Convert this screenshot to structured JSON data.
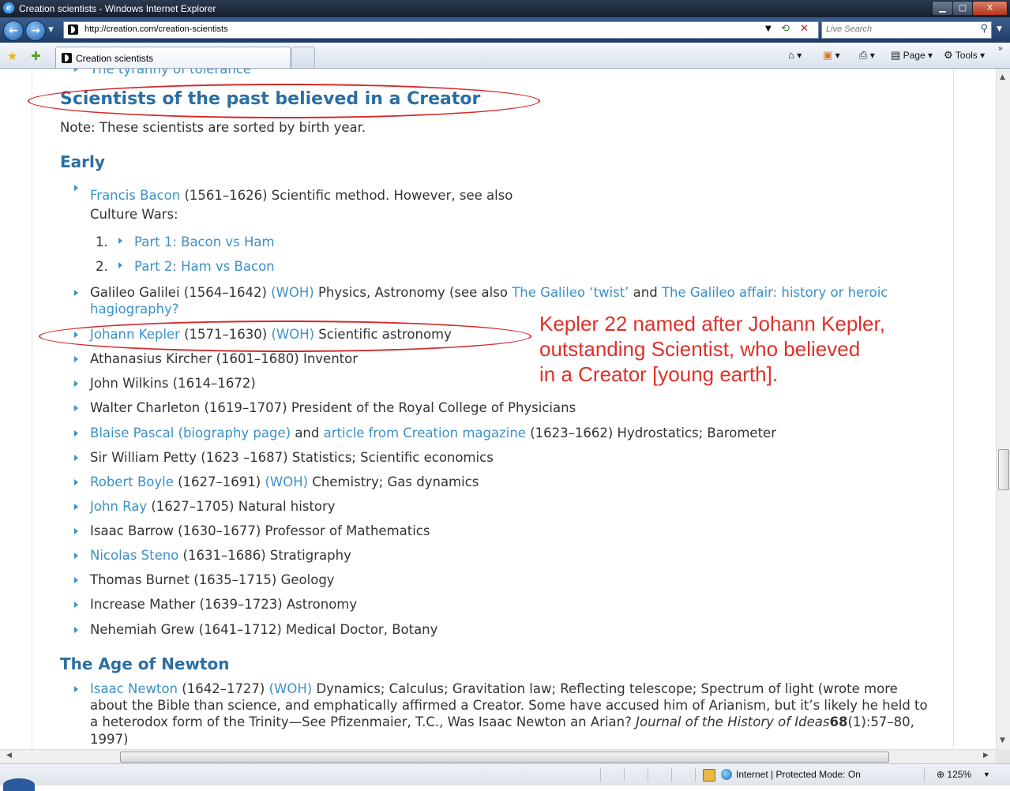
{
  "window": {
    "title": "Creation scientists - Windows Internet Explorer",
    "min_glyph": "▁",
    "max_glyph": "▢",
    "close_glyph": "X"
  },
  "address_bar": {
    "url": "http://creation.com/creation-scientists",
    "search_placeholder": "Live Search"
  },
  "tab": {
    "title": "Creation scientists"
  },
  "commands": {
    "page": "Page",
    "tools": "Tools"
  },
  "page": {
    "cut_item": "The tyranny of tolerance",
    "heading": "Scientists of the past believed in a Creator",
    "note": "Note: These scientists are sorted by birth year.",
    "early_heading": "Early",
    "bacon": {
      "link": "Francis Bacon",
      "text": " (1561–1626) Scientific method. However, see also",
      "text2": "Culture Wars:",
      "part1_num": "1.",
      "part1": "Part 1: Bacon vs Ham",
      "part2_num": "2.",
      "part2": "Part 2: Ham vs Bacon"
    },
    "galileo": {
      "text": "Galileo Galilei (1564–1642) ",
      "woh": "(WOH)",
      "text2": " Physics, Astronomy (see also ",
      "link1": "The Galileo ‘twist’",
      "and": " and ",
      "link2a": "The Galileo affair: history or heroic",
      "link2b": "hagiography?"
    },
    "kepler": {
      "link": "Johann Kepler",
      "text": " (1571–1630) ",
      "woh": "(WOH)",
      "text2": " Scientific astronomy"
    },
    "kircher": "Athanasius Kircher (1601–1680) Inventor",
    "wilkins": "John Wilkins (1614–1672)",
    "charleton": "Walter Charleton (1619–1707) President of the Royal College of Physicians",
    "pascal": {
      "link1": "Blaise Pascal (biography page)",
      "and": " and ",
      "link2": "article from Creation magazine",
      "text": " (1623–1662) Hydrostatics; Barometer"
    },
    "petty": "Sir William Petty (1623 –1687) Statistics; Scientific economics",
    "boyle": {
      "link": "Robert Boyle",
      "text": " (1627–1691) ",
      "woh": "(WOH)",
      "text2": " Chemistry; Gas dynamics"
    },
    "ray": {
      "link": "John Ray",
      "text": " (1627–1705) Natural history"
    },
    "barrow": "Isaac Barrow (1630–1677) Professor of Mathematics",
    "steno": {
      "link": "Nicolas Steno",
      "text": " (1631–1686) Stratigraphy"
    },
    "burnet": "Thomas Burnet (1635–1715) Geology",
    "mather": "Increase Mather (1639–1723) Astronomy",
    "grew": "Nehemiah Grew (1641–1712) Medical Doctor, Botany",
    "newton_heading": "The Age of Newton",
    "newton": {
      "link": "Isaac Newton",
      "text": " (1642–1727) ",
      "woh": "(WOH)",
      "text2": " Dynamics; Calculus; Gravitation law; Reflecting telescope; Spectrum of light (wrote more",
      "line2": "about the Bible than science, and emphatically affirmed a Creator. Some have accused him of Arianism, but it’s likely he held to",
      "line3a": "a heterodox form of the Trinity—See Pfizenmaier, T.C., Was Isaac Newton an Arian? ",
      "journal": "Journal of the History of Ideas",
      "volume": "68",
      "line3b": "(1):57–80,",
      "line4": "1997)"
    }
  },
  "annotation": {
    "line1": "Kepler 22 named after Johann Kepler,",
    "line2": "outstanding Scientist, who believed",
    "line3": "in a Creator [young earth]."
  },
  "status_bar": {
    "zone": "Internet | Protected Mode: On",
    "zoom": "125%"
  },
  "colors": {
    "link": "#3b90c8",
    "heading": "#2b6ea3",
    "annotation": "#e0302a"
  }
}
